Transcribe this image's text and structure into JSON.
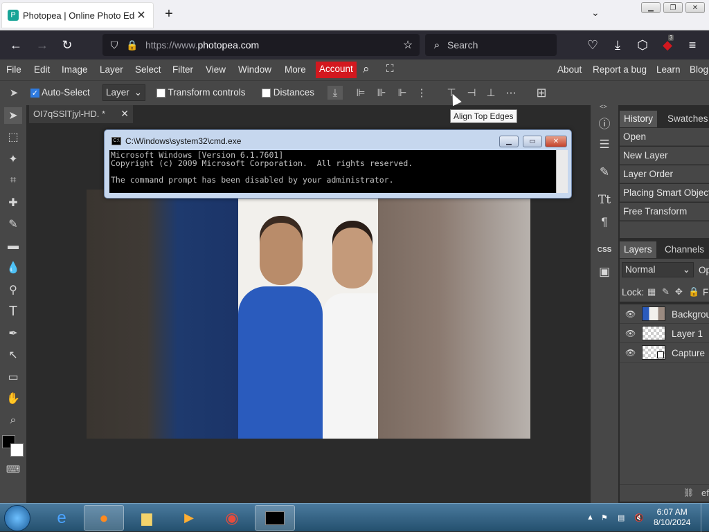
{
  "browser": {
    "tab_title": "Photopea | Online Photo Editor",
    "favicon": "P",
    "url_prefix": "https://www.",
    "url_domain": "photopea.com",
    "search_placeholder": "Search",
    "notification_count": "3"
  },
  "menubar": {
    "items": [
      "File",
      "Edit",
      "Image",
      "Layer",
      "Select",
      "Filter",
      "View",
      "Window",
      "More"
    ],
    "account": "Account",
    "right_items": [
      "About",
      "Report a bug",
      "Learn",
      "Blog"
    ],
    "account_color": "#d3181f"
  },
  "options": {
    "auto_select_label": "Auto-Select",
    "auto_select_checked": true,
    "target_select": "Layer",
    "transform_controls_label": "Transform controls",
    "distances_label": "Distances"
  },
  "tooltip": "Align Top Edges",
  "document": {
    "tab_title": "OI7qSSlTjyl-HD.",
    "tab_modified": "*"
  },
  "cmd": {
    "title": "C:\\Windows\\system32\\cmd.exe",
    "lines": [
      "Microsoft Windows [Version 6.1.7601]",
      "Copyright (c) 2009 Microsoft Corporation.  All rights reserved.",
      "",
      "The command prompt has been disabled by your administrator."
    ]
  },
  "panels": {
    "history_tabs": [
      "History",
      "Swatches"
    ],
    "history_items": [
      "Open",
      "New Layer",
      "Layer Order",
      "Placing Smart Object",
      "Free Transform"
    ],
    "layers_tabs": [
      "Layers",
      "Channels"
    ],
    "blend_mode": "Normal",
    "opacity_label": "Op",
    "lock_label": "Lock:",
    "fill_label": "F",
    "layers": [
      "Background",
      "Layer 1",
      "Capture"
    ],
    "footer_text": "ef"
  },
  "rcol_labels": {
    "css": "CSS"
  },
  "taskbar": {
    "time": "6:07 AM",
    "date": "8/10/2024"
  }
}
